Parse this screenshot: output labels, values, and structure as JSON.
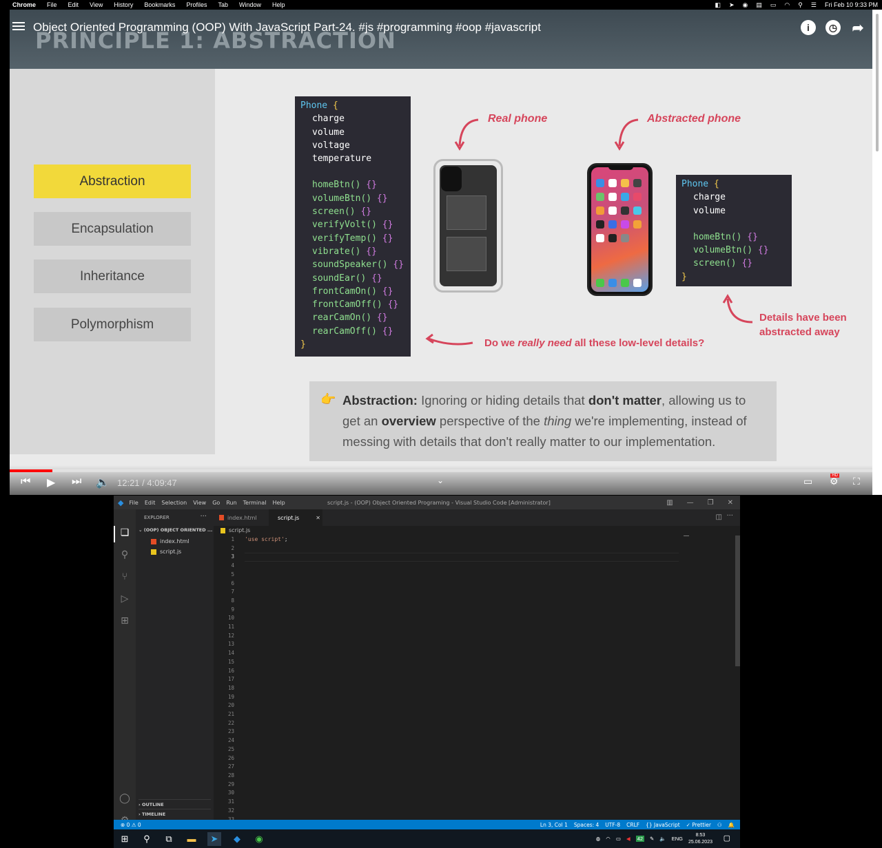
{
  "mac_menu": {
    "app": "Chrome",
    "items": [
      "File",
      "Edit",
      "View",
      "History",
      "Bookmarks",
      "Profiles",
      "Tab",
      "Window",
      "Help"
    ],
    "datetime": "Fri Feb 10  9:33 PM"
  },
  "video": {
    "title": "Object Oriented Programming (OOP) With JavaScript Part-24. #js #programming #oop #javascript",
    "slide_heading": "PRINCIPLE 1: ABSTRACTION",
    "principles": [
      "Abstraction",
      "Encapsulation",
      "Inheritance",
      "Polymorphism"
    ],
    "active_principle": "Abstraction",
    "full_code": {
      "name": "Phone",
      "props": [
        "charge",
        "volume",
        "voltage",
        "temperature"
      ],
      "methods": [
        "homeBtn()",
        "volumeBtn()",
        "screen()",
        "verifyVolt()",
        "verifyTemp()",
        "vibrate()",
        "soundSpeaker()",
        "soundEar()",
        "frontCamOn()",
        "frontCamOff()",
        "rearCamOn()",
        "rearCamOff()"
      ]
    },
    "abstract_code": {
      "name": "Phone",
      "props": [
        "charge",
        "volume"
      ],
      "methods": [
        "homeBtn()",
        "volumeBtn()",
        "screen()"
      ]
    },
    "labels": {
      "real_phone": "Real phone",
      "abstracted_phone": "Abstracted phone",
      "question_pre": "Do we ",
      "question_em": "really need",
      "question_post": " all these low-level details?",
      "details_line1": "Details have been",
      "details_line2": "abstracted away"
    },
    "definition": {
      "term": "Abstraction:",
      "p1": " Ignoring or hiding details that ",
      "b1": "don't matter",
      "p2": ", allowing us to get an ",
      "b2": "overview",
      "p3": " perspective of the ",
      "i1": "thing",
      "p4": " we're implementing, instead of messing with details that don't really matter to our implementation."
    },
    "time_display": "12:21 / 4:09:47",
    "progress_fraction": 0.0493
  },
  "vscode": {
    "menu": [
      "File",
      "Edit",
      "Selection",
      "View",
      "Go",
      "Run",
      "Terminal",
      "Help"
    ],
    "window_title": "script.js - (OOP) Object Oriented Programing - Visual Studio Code [Administrator]",
    "explorer_label": "EXPLORER",
    "folder": "(OOP) OBJECT ORIENTED ...",
    "files": [
      "index.html",
      "script.js"
    ],
    "tabs": [
      "index.html",
      "script.js"
    ],
    "active_tab": "script.js",
    "breadcrumb": "script.js",
    "code_line1": "'use script'",
    "code_line1_punc": ";",
    "line_count": 33,
    "outline": "OUTLINE",
    "timeline": "TIMELINE",
    "status": {
      "problems": "⊗ 0 ⚠ 0",
      "position": "Ln 3, Col 1",
      "spaces": "Spaces: 4",
      "encoding": "UTF-8",
      "eol": "CRLF",
      "language": "{} JavaScript",
      "formatter": "✓ Prettier"
    }
  },
  "taskbar": {
    "lang": "ENG",
    "time": "8:53",
    "date": "25.06.2023",
    "battery_badge": "42"
  },
  "colors": {
    "accent_yellow": "#f2d93a",
    "accent_red": "#d6455b",
    "vscode_blue": "#007acc",
    "youtube_red": "#ff0000"
  }
}
